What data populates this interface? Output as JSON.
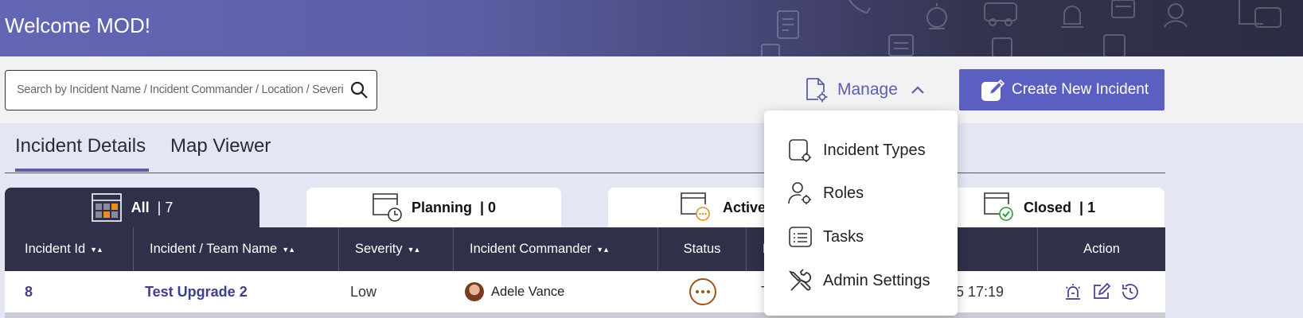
{
  "header": {
    "welcome": "Welcome MOD!"
  },
  "search": {
    "placeholder": "Search by Incident Name / Incident Commander / Location / Severity",
    "value": ""
  },
  "manage": {
    "label": "Manage",
    "expanded": true
  },
  "create_button": {
    "label": "Create New Incident"
  },
  "tabs": [
    {
      "label": "Incident Details",
      "active": true
    },
    {
      "label": "Map Viewer",
      "active": false
    }
  ],
  "filter_tabs": {
    "all": {
      "label": "All",
      "count": "| 7"
    },
    "planning": {
      "label": "Planning",
      "count": "| 0"
    },
    "active": {
      "label": "Active"
    },
    "closed": {
      "label": "Closed",
      "count": "| 1"
    }
  },
  "table": {
    "columns": {
      "id": "Incident Id",
      "name": "Incident / Team Name",
      "severity": "Severity",
      "commander": "Incident Commander",
      "status": "Status",
      "location": "L",
      "action": "Action"
    },
    "rows": [
      {
        "id": "8",
        "name": "Test Upgrade 2",
        "severity": "Low",
        "commander": "Adele Vance",
        "location": "T",
        "date": "5 17:19"
      }
    ]
  },
  "manage_menu": {
    "items": [
      {
        "label": "Incident Types",
        "icon": "incident-types-icon"
      },
      {
        "label": "Roles",
        "icon": "roles-icon"
      },
      {
        "label": "Tasks",
        "icon": "tasks-icon"
      },
      {
        "label": "Admin Settings",
        "icon": "admin-settings-icon"
      }
    ]
  },
  "colors": {
    "accent": "#5c5fa6",
    "button": "#5c5fc2",
    "dark": "#30304a",
    "status": "#a0541c",
    "closed_check": "#2e9a3e",
    "active_ring": "#e8901c"
  }
}
